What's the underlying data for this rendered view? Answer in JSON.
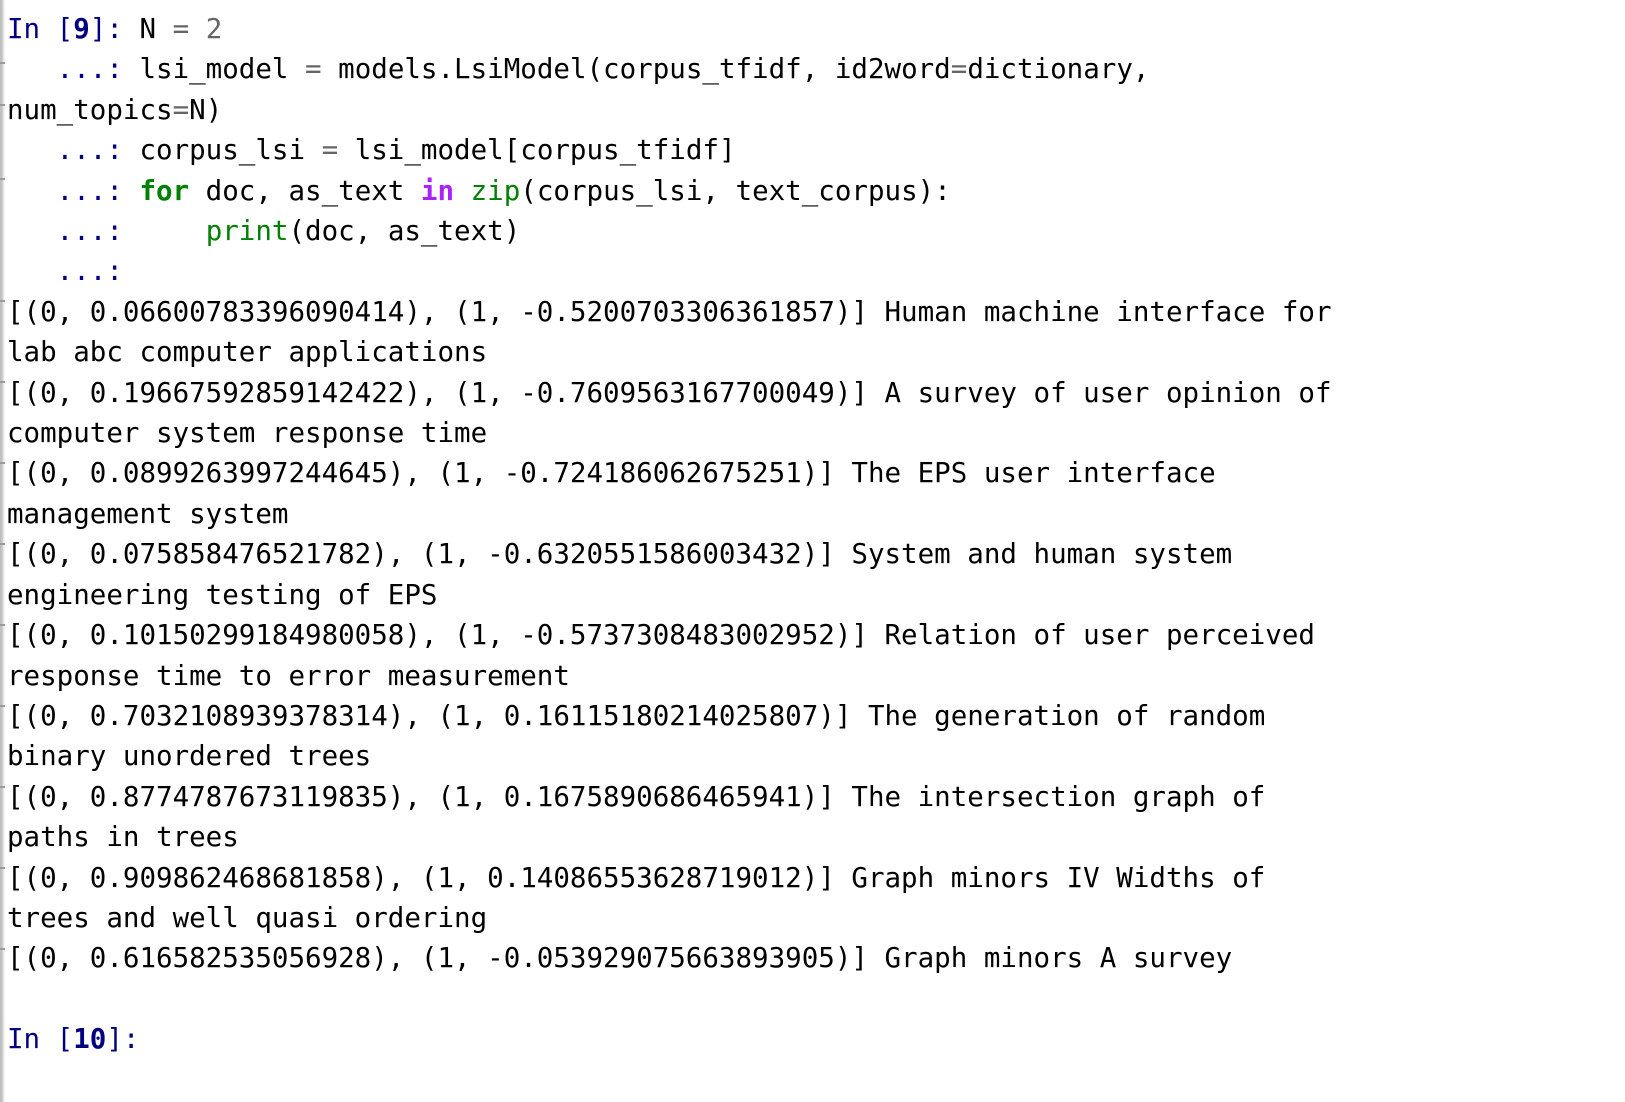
{
  "app": {
    "kind": "ipython-console",
    "colors": {
      "background": "#ffffff",
      "foreground": "#000000",
      "prompt": "#000080",
      "operator": "#666666",
      "number": "#666666",
      "keyword": "#008000",
      "keyword_operator": "#aa22ff",
      "builtin": "#008000",
      "rail": "#c9c9c9"
    }
  },
  "prompts": {
    "in_label": "In [",
    "in_close": "]: ",
    "continuation": "   ...: ",
    "current_number": "9",
    "next_number": "10",
    "next_close": "]:"
  },
  "code": {
    "line1": {
      "prompt_open": "In [",
      "number": "9",
      "prompt_close": "]: ",
      "var": "N ",
      "op": "=",
      "value": " 2"
    },
    "line2": {
      "cont": "   ...: ",
      "text_a": "lsi_model ",
      "op1": "=",
      "text_b": " models.LsiModel(corpus_tfidf, id2word",
      "op2": "=",
      "text_c": "dictionary,"
    },
    "line2_wrap": "num_topics=N)",
    "line2_wrap_a": "num_topics",
    "line2_wrap_op": "=",
    "line2_wrap_b": "N)",
    "line3": {
      "cont": "   ...: ",
      "text_a": "corpus_lsi ",
      "op": "=",
      "text_b": " lsi_model[corpus_tfidf]"
    },
    "line4": {
      "cont": "   ...: ",
      "kw_for": "for",
      "text_a": " doc, as_text ",
      "kw_in": "in",
      "space": " ",
      "builtin_zip": "zip",
      "text_b": "(corpus_lsi, text_corpus):"
    },
    "line5": {
      "cont": "   ...:     ",
      "builtin_print": "print",
      "text": "(doc, as_text)"
    },
    "line6": {
      "cont": "   ...: "
    }
  },
  "output": {
    "results": [
      {
        "vector": "[(0, 0.06600783396090414), (1, -0.5200703306361857)] ",
        "doc_part1": "Human machine interface for",
        "doc_part2": "lab abc computer applications",
        "topic0": 0.06600783396090414,
        "topic1": -0.5200703306361857,
        "document": "Human machine interface for lab abc computer applications"
      },
      {
        "vector": "[(0, 0.19667592859142422), (1, -0.7609563167700049)] ",
        "doc_part1": "A survey of user opinion of",
        "doc_part2": "computer system response time",
        "topic0": 0.19667592859142422,
        "topic1": -0.7609563167700049,
        "document": "A survey of user opinion of computer system response time"
      },
      {
        "vector": "[(0, 0.0899263997244645), (1, -0.724186062675251)] ",
        "doc_part1": "The EPS user interface",
        "doc_part2": "management system",
        "topic0": 0.0899263997244645,
        "topic1": -0.724186062675251,
        "document": "The EPS user interface management system"
      },
      {
        "vector": "[(0, 0.075858476521782), (1, -0.6320551586003432)] ",
        "doc_part1": "System and human system",
        "doc_part2": "engineering testing of EPS",
        "topic0": 0.075858476521782,
        "topic1": -0.6320551586003432,
        "document": "System and human system engineering testing of EPS"
      },
      {
        "vector": "[(0, 0.10150299184980058), (1, -0.5737308483002952)] ",
        "doc_part1": "Relation of user perceived",
        "doc_part2": "response time to error measurement",
        "topic0": 0.10150299184980058,
        "topic1": -0.5737308483002952,
        "document": "Relation of user perceived response time to error measurement"
      },
      {
        "vector": "[(0, 0.7032108939378314), (1, 0.16115180214025807)] ",
        "doc_part1": "The generation of random",
        "doc_part2": "binary unordered trees",
        "topic0": 0.7032108939378314,
        "topic1": 0.16115180214025807,
        "document": "The generation of random binary unordered trees"
      },
      {
        "vector": "[(0, 0.8774787673119835), (1, 0.1675890686465941)] ",
        "doc_part1": "The intersection graph of",
        "doc_part2": "paths in trees",
        "topic0": 0.8774787673119835,
        "topic1": 0.1675890686465941,
        "document": "The intersection graph of paths in trees"
      },
      {
        "vector": "[(0, 0.909862468681858), (1, 0.14086553628719012)] ",
        "doc_part1": "Graph minors IV Widths of",
        "doc_part2": "trees and well quasi ordering",
        "topic0": 0.909862468681858,
        "topic1": 0.14086553628719012,
        "document": "Graph minors IV Widths of trees and well quasi ordering"
      },
      {
        "vector": "[(0, 0.616582535056928), (1, -0.053929075663893905)] ",
        "doc_part1": "Graph minors A survey",
        "doc_part2": "",
        "topic0": 0.616582535056928,
        "topic1": -0.053929075663893905,
        "document": "Graph minors A survey"
      }
    ]
  },
  "next_prompt": {
    "open": "In [",
    "number": "10",
    "close": "]:"
  }
}
